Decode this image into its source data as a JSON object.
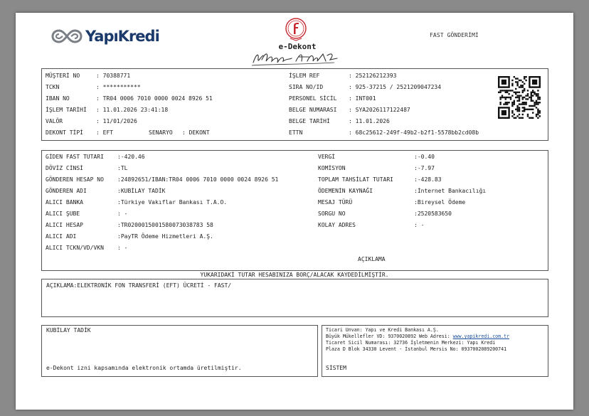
{
  "header": {
    "brand": "YapıKredi",
    "doc_title": "e-Dekont",
    "doc_type": "FAST GÖNDERİMİ"
  },
  "info": {
    "left": [
      {
        "label": "MÜŞTERİ NO",
        "value": ": 70388771"
      },
      {
        "label": "TCKN",
        "value": ": ***********"
      },
      {
        "label": "IBAN NO",
        "value": ": TR04 0006 7010 0000 0024 8926 51"
      },
      {
        "label": "İŞLEM TARİHİ",
        "value": ": 11.01.2026 23:41:18"
      },
      {
        "label": "VALÖR",
        "value": ": 11/01/2026"
      },
      {
        "label": "DEKONT TİPİ",
        "value": ": EFT"
      }
    ],
    "senaryo_label": "SENARYO",
    "senaryo_value": ": DEKONT",
    "right": [
      {
        "label": "İŞLEM REF",
        "value": ": 252126212393"
      },
      {
        "label": "SIRA NO/ID",
        "value": ": 925-37215 / 2521209047234"
      },
      {
        "label": "PERSONEL SİCİL",
        "value": ": INT001"
      },
      {
        "label": "BELGE NUMARASI",
        "value": ": SYA2026117122487"
      },
      {
        "label": "BELGE TARİHİ",
        "value": ": 11.01.2026"
      },
      {
        "label": "ETTN",
        "value": ": 68c25612-249f-49b2-b2f1-5578bb2cd08b"
      }
    ]
  },
  "transfer": {
    "left": [
      {
        "label": "GİDEN FAST TUTARI",
        "value": ":-420.46"
      },
      {
        "label": "DÖVİZ CİNSİ",
        "value": ":TL"
      },
      {
        "label": "GÖNDEREN HESAP NO",
        "value": ":24892651/IBAN:TR04 0006 7010 0000 0024 8926 51"
      },
      {
        "label": "GÖNDEREN ADI",
        "value": ":KUBİLAY TADİK"
      },
      {
        "label": "ALICI BANKA",
        "value": ":Türkiye Vakıflar Bankası T.A.O."
      },
      {
        "label": "ALICI ŞUBE",
        "value": ": -"
      },
      {
        "label": "ALICI HESAP",
        "value": ":TR0200015001580073038783 58"
      },
      {
        "label": "ALICI ADI",
        "value": ":PayTR Ödeme Hizmetleri A.Ş."
      },
      {
        "label": "ALICI TCKN/VD/VKN",
        "value": ": -"
      }
    ],
    "right": [
      {
        "label": "VERGİ",
        "value": ":-0.40"
      },
      {
        "label": "KOMİSYON",
        "value": ":-7.97"
      },
      {
        "label": "TOPLAM TAHSİLAT TUTARI",
        "value": ":-428.83"
      },
      {
        "label": "ÖDEMENİN KAYNAĞI",
        "value": ":İnternet Bankacılığı"
      },
      {
        "label": "MESAJ TÜRÜ",
        "value": ":Bireysel Ödeme"
      },
      {
        "label": "SORGU NO",
        "value": ":2520583650"
      },
      {
        "label": "KOLAY ADRES",
        "value": ": -"
      }
    ],
    "aciklama_title": "AÇIKLAMA"
  },
  "notice": "YUKARIDAKİ TUTAR HESABINIZA BORÇ/ALACAK KAYDEDİLMİŞTİR.",
  "description": "AÇIKLAMA:ELEKTRONİK FON TRANSFERİ (EFT) ÜCRETİ - FAST/",
  "footer_left": {
    "name": "KUBİLAY TADİK",
    "note": "e-Dekont izni kapsamında elektronik ortamda üretilmiştir."
  },
  "footer_right": {
    "line1": "Ticari Unvan: Yapı ve Kredi Bankası A.Ş.",
    "line2_prefix": "Büyük Mükellefler VD: 9370020892 Web Adresi: ",
    "line2_link": "www.yapikredi.com.tr",
    "line3": "Ticaret Sicil Numarası: 32736 İşletmenin Merkezi: Yapı Kredi",
    "line4": "Plaza D Blok 34330 Levent - İstanbul Mersis No: 0937002089200741",
    "system": "SİSTEM"
  }
}
